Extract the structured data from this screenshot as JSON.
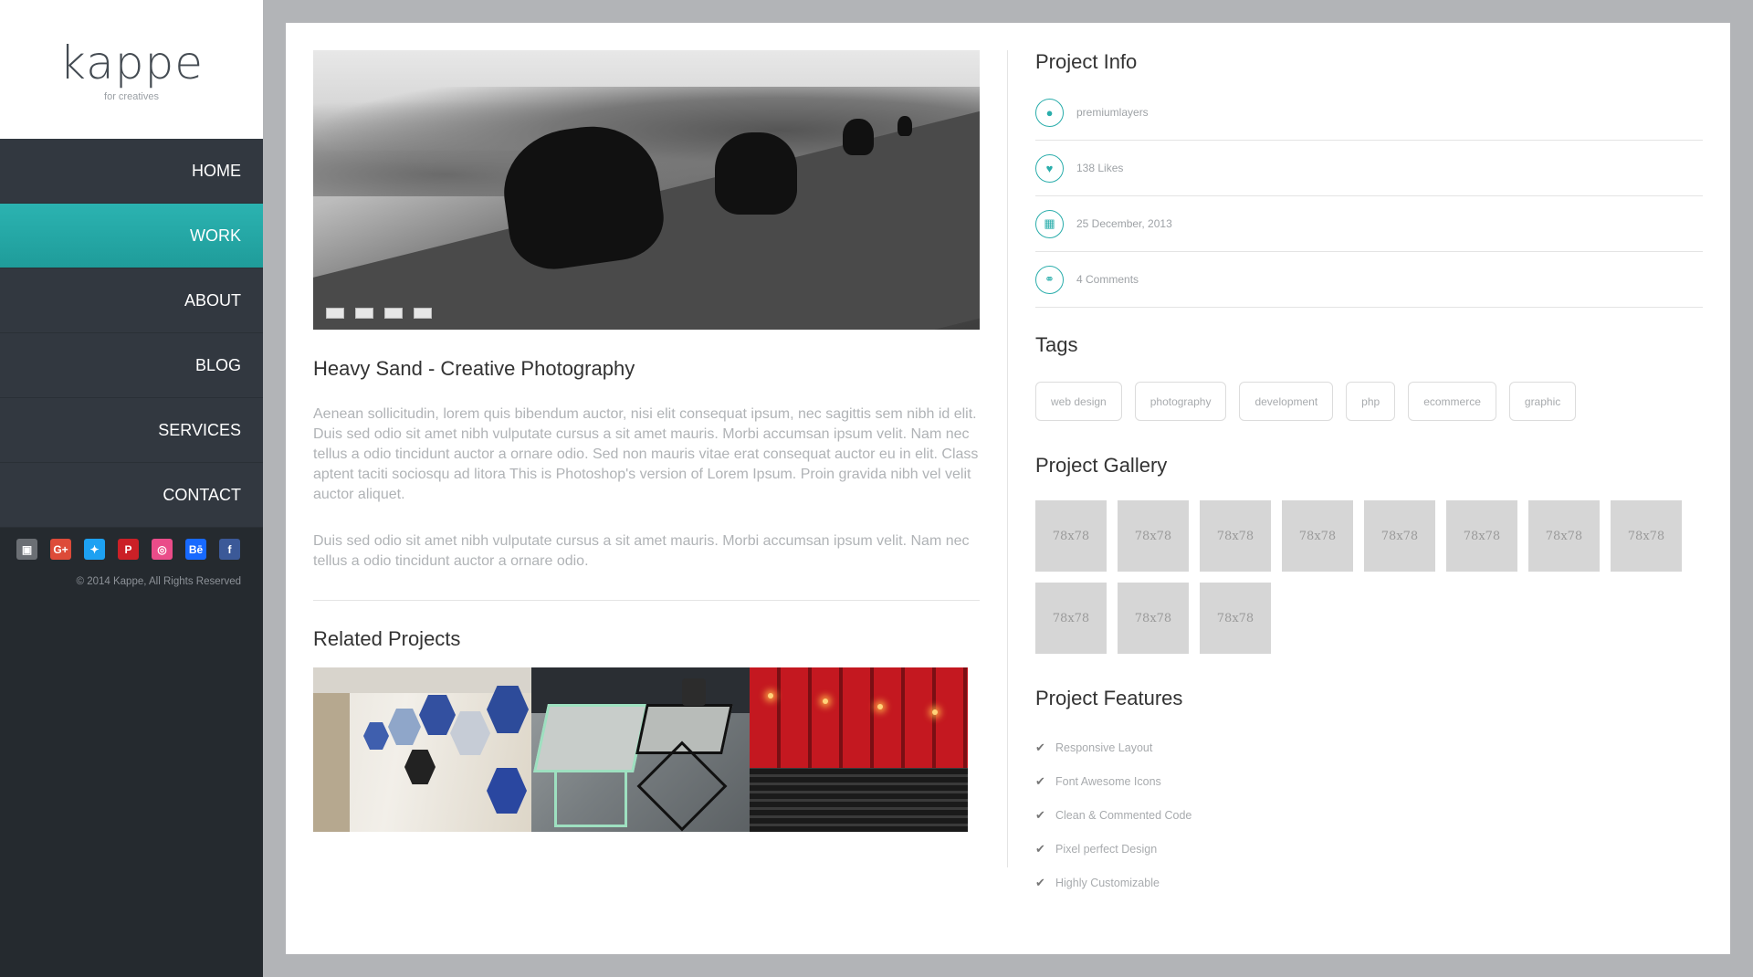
{
  "brand": {
    "name": "kappe",
    "tagline": "for creatives"
  },
  "nav": [
    {
      "label": "HOME",
      "active": false
    },
    {
      "label": "WORK",
      "active": true
    },
    {
      "label": "ABOUT",
      "active": false
    },
    {
      "label": "BLOG",
      "active": false
    },
    {
      "label": "SERVICES",
      "active": false
    },
    {
      "label": "CONTACT",
      "active": false
    }
  ],
  "socials": [
    {
      "name": "flickr-icon",
      "glyph": "▣",
      "color": "#6b6f74"
    },
    {
      "name": "google-plus-icon",
      "glyph": "G+",
      "color": "#dd4b39"
    },
    {
      "name": "twitter-icon",
      "glyph": "✦",
      "color": "#1da1f2"
    },
    {
      "name": "pinterest-icon",
      "glyph": "P",
      "color": "#cb2027"
    },
    {
      "name": "dribbble-icon",
      "glyph": "◎",
      "color": "#ea4c89"
    },
    {
      "name": "behance-icon",
      "glyph": "Bē",
      "color": "#1769ff"
    },
    {
      "name": "facebook-icon",
      "glyph": "f",
      "color": "#3b5998"
    }
  ],
  "copyright": "© 2014 Kappe, All Rights Reserved",
  "post": {
    "title": "Heavy Sand - Creative Photography",
    "paragraph1": "Aenean sollicitudin, lorem quis bibendum auctor, nisi elit consequat ipsum, nec sagittis sem nibh id elit. Duis sed odio sit amet nibh vulputate cursus a sit amet mauris. Morbi accumsan ipsum velit. Nam nec tellus a odio tincidunt auctor a ornare odio. Sed non mauris vitae erat consequat auctor eu in elit. Class aptent taciti sociosqu ad litora This is Photoshop's version of Lorem Ipsum. Proin gravida nibh vel velit auctor aliquet.",
    "paragraph2": "Duis sed odio sit amet nibh vulputate cursus a sit amet mauris. Morbi accumsan ipsum velit. Nam nec tellus a odio tincidunt auctor a ornare odio."
  },
  "related": {
    "title": "Related Projects"
  },
  "info": {
    "title": "Project Info",
    "rows": [
      {
        "icon": "user-icon",
        "glyph": "👤",
        "text": "premiumlayers"
      },
      {
        "icon": "heart-icon",
        "glyph": "♥",
        "text": "138 Likes"
      },
      {
        "icon": "calendar-icon",
        "glyph": "▦",
        "text": "25 December, 2013"
      },
      {
        "icon": "link-icon",
        "glyph": "⚭",
        "text": "4 Comments"
      }
    ]
  },
  "tags": {
    "title": "Tags",
    "items": [
      "web design",
      "photography",
      "development",
      "php",
      "ecommerce",
      "graphic"
    ]
  },
  "gallery": {
    "title": "Project Gallery",
    "items": [
      "78x78",
      "78x78",
      "78x78",
      "78x78",
      "78x78",
      "78x78",
      "78x78",
      "78x78",
      "78x78",
      "78x78",
      "78x78"
    ]
  },
  "features": {
    "title": "Project Features",
    "items": [
      "Responsive Layout",
      "Font Awesome Icons",
      "Clean & Commented Code",
      "Pixel perfect Design",
      "Highly Customizable"
    ]
  },
  "colors": {
    "accent": "#2aadab",
    "sidebar": "#252a2f",
    "nav": "#323840",
    "page_bg": "#b2b4b7"
  }
}
